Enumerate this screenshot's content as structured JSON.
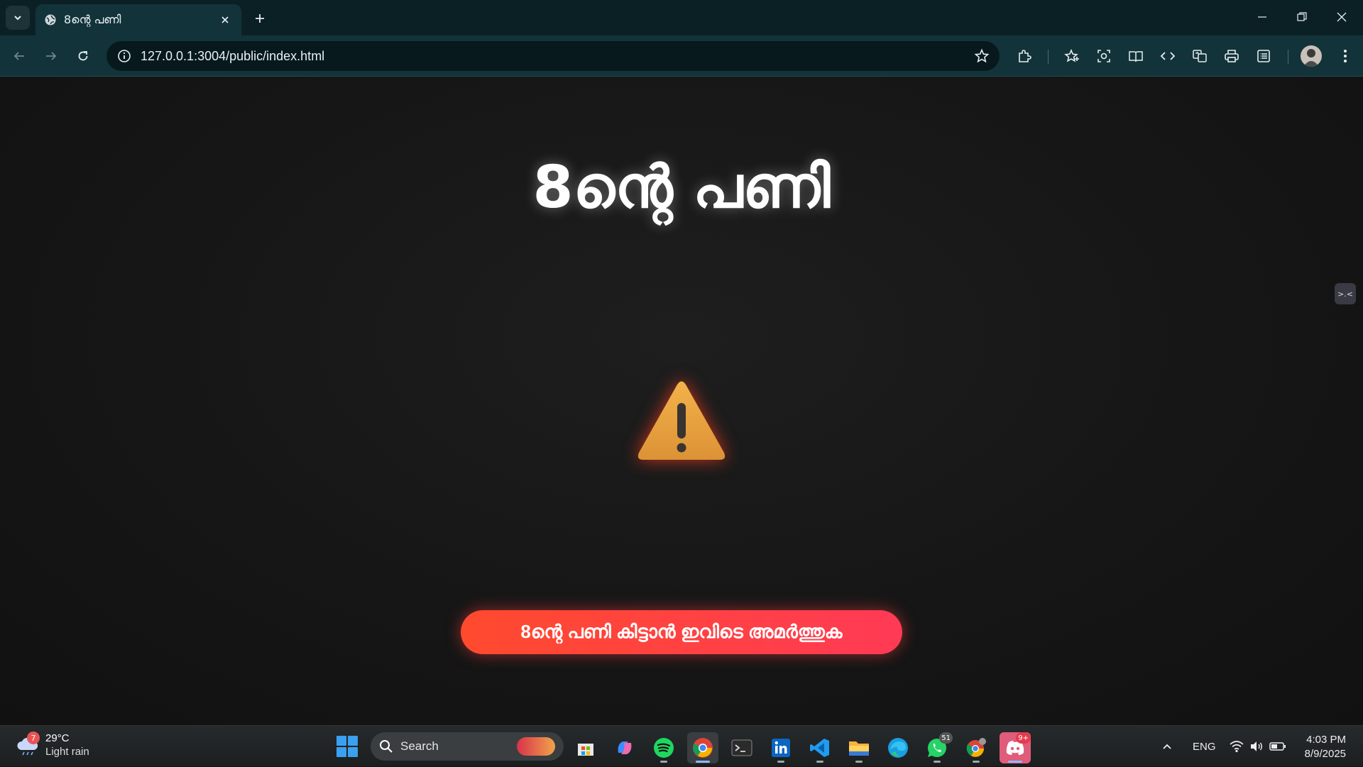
{
  "browser": {
    "tab_title": "8ന്റെ പണി",
    "url": "127.0.0.1:3004/public/index.html",
    "colors": {
      "titlebar": "#0b2025",
      "toolbar": "#13333a",
      "omnibox": "#07191d"
    }
  },
  "page": {
    "title": "8ന്റെ പണി",
    "warning_icon": "warning-triangle-icon",
    "cta_label": "8ന്റെ പണി കിട്ടാൻ ഇവിടെ അമർത്തുക",
    "side_helper": ">.<",
    "colors": {
      "background": "#161616",
      "cta_start": "#ff4a2e",
      "cta_end": "#ff3a55",
      "warning": "#e8a13c"
    }
  },
  "taskbar": {
    "weather": {
      "badge": "7",
      "temp": "29°C",
      "desc": "Light rain"
    },
    "search_placeholder": "Search",
    "apps": [
      {
        "name": "microsoft-store"
      },
      {
        "name": "copilot"
      },
      {
        "name": "spotify"
      },
      {
        "name": "chrome",
        "active": true
      },
      {
        "name": "terminal"
      },
      {
        "name": "linkedin"
      },
      {
        "name": "vscode"
      },
      {
        "name": "file-explorer"
      },
      {
        "name": "edge"
      },
      {
        "name": "whatsapp",
        "badge": "51"
      },
      {
        "name": "chrome-profile"
      },
      {
        "name": "discord",
        "badge": "9+"
      }
    ],
    "language": "ENG",
    "time": "4:03 PM",
    "date": "8/9/2025"
  }
}
